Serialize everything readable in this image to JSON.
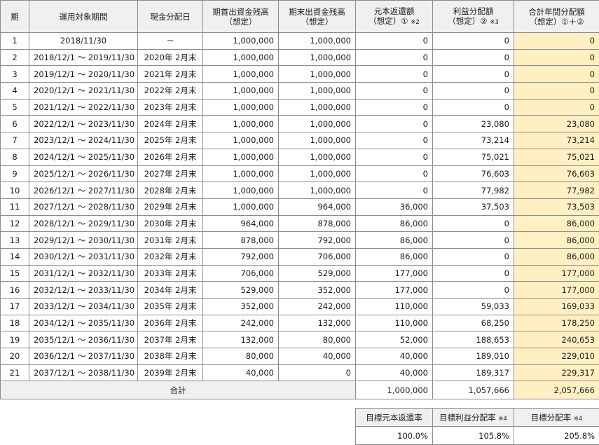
{
  "headers": {
    "period": "期",
    "range": "運用対象期間",
    "date": "現金分配日",
    "begin_line1": "期首出資金残高",
    "begin_line2": "（想定）",
    "end_line1": "期末出資金残高",
    "end_line2": "（想定）",
    "principal_line1": "元本返還額",
    "principal_line2": "（想定）①",
    "principal_note": "※2",
    "profit_line1": "利益分配額",
    "profit_line2": "（想定）②",
    "profit_note": "※3",
    "total_line1": "合計年間分配額",
    "total_line2": "（想定）①＋②"
  },
  "rows": [
    {
      "period": "1",
      "range": "2018/11/30",
      "date": "－",
      "begin": "1,000,000",
      "end": "1,000,000",
      "principal": "0",
      "profit": "0",
      "total": "0"
    },
    {
      "period": "2",
      "range": "2018/12/1 ～ 2019/11/30",
      "date": "2020年 2月末",
      "begin": "1,000,000",
      "end": "1,000,000",
      "principal": "0",
      "profit": "0",
      "total": "0"
    },
    {
      "period": "3",
      "range": "2019/12/1 ～ 2020/11/30",
      "date": "2021年 2月末",
      "begin": "1,000,000",
      "end": "1,000,000",
      "principal": "0",
      "profit": "0",
      "total": "0"
    },
    {
      "period": "4",
      "range": "2020/12/1 ～ 2021/11/30",
      "date": "2022年 2月末",
      "begin": "1,000,000",
      "end": "1,000,000",
      "principal": "0",
      "profit": "0",
      "total": "0"
    },
    {
      "period": "5",
      "range": "2021/12/1 ～ 2022/11/30",
      "date": "2023年 2月末",
      "begin": "1,000,000",
      "end": "1,000,000",
      "principal": "0",
      "profit": "0",
      "total": "0"
    },
    {
      "period": "6",
      "range": "2022/12/1 ～ 2023/11/30",
      "date": "2024年 2月末",
      "begin": "1,000,000",
      "end": "1,000,000",
      "principal": "0",
      "profit": "23,080",
      "total": "23,080"
    },
    {
      "period": "7",
      "range": "2023/12/1 ～ 2024/11/30",
      "date": "2025年 2月末",
      "begin": "1,000,000",
      "end": "1,000,000",
      "principal": "0",
      "profit": "73,214",
      "total": "73,214"
    },
    {
      "period": "8",
      "range": "2024/12/1 ～ 2025/11/30",
      "date": "2026年 2月末",
      "begin": "1,000,000",
      "end": "1,000,000",
      "principal": "0",
      "profit": "75,021",
      "total": "75,021"
    },
    {
      "period": "9",
      "range": "2025/12/1 ～ 2026/11/30",
      "date": "2027年 2月末",
      "begin": "1,000,000",
      "end": "1,000,000",
      "principal": "0",
      "profit": "76,603",
      "total": "76,603"
    },
    {
      "period": "10",
      "range": "2026/12/1 ～ 2027/11/30",
      "date": "2028年 2月末",
      "begin": "1,000,000",
      "end": "1,000,000",
      "principal": "0",
      "profit": "77,982",
      "total": "77,982"
    },
    {
      "period": "11",
      "range": "2027/12/1 ～ 2028/11/30",
      "date": "2029年 2月末",
      "begin": "1,000,000",
      "end": "964,000",
      "principal": "36,000",
      "profit": "37,503",
      "total": "73,503"
    },
    {
      "period": "12",
      "range": "2028/12/1 ～ 2029/11/30",
      "date": "2030年 2月末",
      "begin": "964,000",
      "end": "878,000",
      "principal": "86,000",
      "profit": "0",
      "total": "86,000"
    },
    {
      "period": "13",
      "range": "2029/12/1 ～ 2030/11/30",
      "date": "2031年 2月末",
      "begin": "878,000",
      "end": "792,000",
      "principal": "86,000",
      "profit": "0",
      "total": "86,000"
    },
    {
      "period": "14",
      "range": "2030/12/1 ～ 2031/11/30",
      "date": "2032年 2月末",
      "begin": "792,000",
      "end": "706,000",
      "principal": "86,000",
      "profit": "0",
      "total": "86,000"
    },
    {
      "period": "15",
      "range": "2031/12/1 ～ 2032/11/30",
      "date": "2033年 2月末",
      "begin": "706,000",
      "end": "529,000",
      "principal": "177,000",
      "profit": "0",
      "total": "177,000"
    },
    {
      "period": "16",
      "range": "2032/12/1 ～ 2033/11/30",
      "date": "2034年 2月末",
      "begin": "529,000",
      "end": "352,000",
      "principal": "177,000",
      "profit": "0",
      "total": "177,000"
    },
    {
      "period": "17",
      "range": "2033/12/1 ～ 2034/11/30",
      "date": "2035年 2月末",
      "begin": "352,000",
      "end": "242,000",
      "principal": "110,000",
      "profit": "59,033",
      "total": "169,033"
    },
    {
      "period": "18",
      "range": "2034/12/1 ～ 2035/11/30",
      "date": "2036年 2月末",
      "begin": "242,000",
      "end": "132,000",
      "principal": "110,000",
      "profit": "68,250",
      "total": "178,250"
    },
    {
      "period": "19",
      "range": "2035/12/1 ～ 2036/11/30",
      "date": "2037年 2月末",
      "begin": "132,000",
      "end": "80,000",
      "principal": "52,000",
      "profit": "188,653",
      "total": "240,653"
    },
    {
      "period": "20",
      "range": "2036/12/1 ～ 2037/11/30",
      "date": "2038年 2月末",
      "begin": "80,000",
      "end": "40,000",
      "principal": "40,000",
      "profit": "189,010",
      "total": "229,010"
    },
    {
      "period": "21",
      "range": "2037/12/1 ～ 2038/11/30",
      "date": "2039年 2月末",
      "begin": "40,000",
      "end": "0",
      "principal": "40,000",
      "profit": "189,317",
      "total": "229,317"
    }
  ],
  "totals": {
    "label": "合計",
    "principal": "1,000,000",
    "profit": "1,057,666",
    "total": "2,057,666"
  },
  "summary": {
    "principal_rate_label": "目標元本返還率",
    "profit_rate_label": "目標利益分配率",
    "profit_rate_note": "※4",
    "dist_rate_label": "目標分配率",
    "dist_rate_note": "※4",
    "principal_rate": "100.0%",
    "profit_rate": "105.8%",
    "dist_rate": "205.8%"
  },
  "colors": {
    "highlight": "#fff0c4",
    "header_bg": "#f0f0f0",
    "border": "#8c8c8c"
  }
}
